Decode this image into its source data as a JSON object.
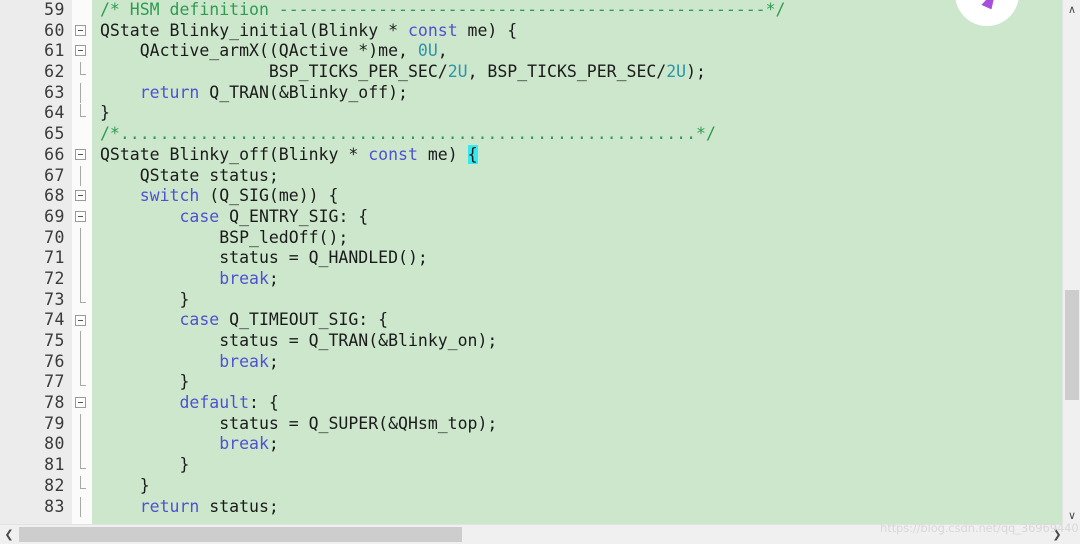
{
  "editor": {
    "language": "c",
    "theme": {
      "code_background": "#CDE7CD",
      "gutter_background": "#ECECEC",
      "fold_column_background": "#FBFBFB",
      "comment_color": "#2E9B4F",
      "keyword_color": "#5050D0",
      "number_color": "#2E95A8",
      "text_color": "#1B1B1B",
      "brace_match_highlight": "#36E8F0",
      "scrollbar_track": "#F0F0F0",
      "scrollbar_thumb": "#CDCDCD"
    },
    "first_line_number": 59,
    "lines": [
      {
        "number": "59",
        "fold": "none",
        "tokens": [
          {
            "t": "/* HSM definition -------------------------------------------------*/",
            "c": "cmt"
          }
        ]
      },
      {
        "number": "60",
        "fold": "box",
        "tokens": [
          {
            "t": "QState Blinky_initial(Blinky * ",
            "c": "plain"
          },
          {
            "t": "const",
            "c": "kw"
          },
          {
            "t": " me) {",
            "c": "plain"
          }
        ]
      },
      {
        "number": "61",
        "fold": "box",
        "tokens": [
          {
            "t": "    QActive_armX((QActive *)me, ",
            "c": "plain"
          },
          {
            "t": "0U",
            "c": "num"
          },
          {
            "t": ",",
            "c": "plain"
          }
        ]
      },
      {
        "number": "62",
        "fold": "tick",
        "tokens": [
          {
            "t": "                 BSP_TICKS_PER_SEC/",
            "c": "plain"
          },
          {
            "t": "2U",
            "c": "num"
          },
          {
            "t": ", BSP_TICKS_PER_SEC/",
            "c": "plain"
          },
          {
            "t": "2U",
            "c": "num"
          },
          {
            "t": ");",
            "c": "plain"
          }
        ]
      },
      {
        "number": "63",
        "fold": "line",
        "tokens": [
          {
            "t": "    ",
            "c": "plain"
          },
          {
            "t": "return",
            "c": "kw"
          },
          {
            "t": " Q_TRAN(&Blinky_off);",
            "c": "plain"
          }
        ]
      },
      {
        "number": "64",
        "fold": "end",
        "tokens": [
          {
            "t": "}",
            "c": "plain"
          }
        ]
      },
      {
        "number": "65",
        "fold": "none",
        "tokens": [
          {
            "t": "/*..........................................................*/",
            "c": "cmt"
          }
        ]
      },
      {
        "number": "66",
        "fold": "box",
        "tokens": [
          {
            "t": "QState Blinky_off(Blinky * ",
            "c": "plain"
          },
          {
            "t": "const",
            "c": "kw"
          },
          {
            "t": " me) ",
            "c": "plain"
          },
          {
            "t": "{",
            "c": "brace-hl"
          }
        ]
      },
      {
        "number": "67",
        "fold": "line",
        "tokens": [
          {
            "t": "    QState status;",
            "c": "plain"
          }
        ]
      },
      {
        "number": "68",
        "fold": "box",
        "tokens": [
          {
            "t": "    ",
            "c": "plain"
          },
          {
            "t": "switch",
            "c": "kw"
          },
          {
            "t": " (Q_SIG(me)) {",
            "c": "plain"
          }
        ]
      },
      {
        "number": "69",
        "fold": "box",
        "tokens": [
          {
            "t": "        ",
            "c": "plain"
          },
          {
            "t": "case",
            "c": "kw"
          },
          {
            "t": " Q_ENTRY_SIG: {",
            "c": "plain"
          }
        ]
      },
      {
        "number": "70",
        "fold": "line",
        "tokens": [
          {
            "t": "            BSP_ledOff();",
            "c": "plain"
          }
        ]
      },
      {
        "number": "71",
        "fold": "line",
        "tokens": [
          {
            "t": "            status = Q_HANDLED();",
            "c": "plain"
          }
        ]
      },
      {
        "number": "72",
        "fold": "line",
        "tokens": [
          {
            "t": "            ",
            "c": "plain"
          },
          {
            "t": "break",
            "c": "kw"
          },
          {
            "t": ";",
            "c": "plain"
          }
        ]
      },
      {
        "number": "73",
        "fold": "tick",
        "tokens": [
          {
            "t": "        }",
            "c": "plain"
          }
        ]
      },
      {
        "number": "74",
        "fold": "box",
        "tokens": [
          {
            "t": "        ",
            "c": "plain"
          },
          {
            "t": "case",
            "c": "kw"
          },
          {
            "t": " Q_TIMEOUT_SIG: {",
            "c": "plain"
          }
        ]
      },
      {
        "number": "75",
        "fold": "line",
        "tokens": [
          {
            "t": "            status = Q_TRAN(&Blinky_on);",
            "c": "plain"
          }
        ]
      },
      {
        "number": "76",
        "fold": "line",
        "tokens": [
          {
            "t": "            ",
            "c": "plain"
          },
          {
            "t": "break",
            "c": "kw"
          },
          {
            "t": ";",
            "c": "plain"
          }
        ]
      },
      {
        "number": "77",
        "fold": "tick",
        "tokens": [
          {
            "t": "        }",
            "c": "plain"
          }
        ]
      },
      {
        "number": "78",
        "fold": "box",
        "tokens": [
          {
            "t": "        ",
            "c": "plain"
          },
          {
            "t": "default",
            "c": "kw"
          },
          {
            "t": ": {",
            "c": "plain"
          }
        ]
      },
      {
        "number": "79",
        "fold": "line",
        "tokens": [
          {
            "t": "            status = Q_SUPER(&QHsm_top);",
            "c": "plain"
          }
        ]
      },
      {
        "number": "80",
        "fold": "line",
        "tokens": [
          {
            "t": "            ",
            "c": "plain"
          },
          {
            "t": "break",
            "c": "kw"
          },
          {
            "t": ";",
            "c": "plain"
          }
        ]
      },
      {
        "number": "81",
        "fold": "tick",
        "tokens": [
          {
            "t": "        }",
            "c": "plain"
          }
        ]
      },
      {
        "number": "82",
        "fold": "tick",
        "tokens": [
          {
            "t": "    }",
            "c": "plain"
          }
        ]
      },
      {
        "number": "83",
        "fold": "line",
        "tokens": [
          {
            "t": "    ",
            "c": "plain"
          },
          {
            "t": "return",
            "c": "kw"
          },
          {
            "t": " status;",
            "c": "plain"
          }
        ]
      }
    ]
  },
  "scrollbars": {
    "vertical": {
      "up_arrow": "∧",
      "down_arrow": "∨"
    },
    "horizontal": {
      "left_arrow": "❮",
      "right_arrow": "❯"
    }
  },
  "watermark": {
    "url_text": "https://blog.csdn.net/qq_36969440",
    "logo_name": "csdn-logo"
  }
}
